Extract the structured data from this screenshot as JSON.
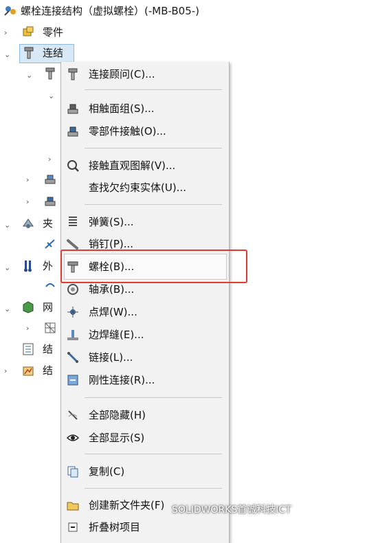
{
  "tree": {
    "title": "螺栓连接结构（虚拟螺栓）(-MB-B05-)",
    "parts_label": "零件",
    "connections_label": "连结",
    "fixtures_label": "夹",
    "external_loads_label": "外",
    "mesh_label": "网",
    "result_options_label": "结",
    "results_label": "结"
  },
  "context_menu": {
    "items": [
      {
        "label": "连接顾问(C)...",
        "icon": "connection-advisor-icon"
      },
      {
        "label": "相触面组(S)...",
        "icon": "contact-set-icon"
      },
      {
        "label": "零部件接触(O)...",
        "icon": "component-contact-icon"
      },
      {
        "label": "接触直观图解(V)...",
        "icon": "contact-visualization-icon"
      },
      {
        "label": "查找欠约束实体(U)...",
        "icon": ""
      },
      {
        "label": "弹簧(S)...",
        "icon": "spring-icon"
      },
      {
        "label": "销钉(P)...",
        "icon": "pin-icon"
      },
      {
        "label": "螺栓(B)...",
        "icon": "bolt-icon"
      },
      {
        "label": "轴承(B)...",
        "icon": "bearing-icon"
      },
      {
        "label": "点焊(W)...",
        "icon": "spot-weld-icon"
      },
      {
        "label": "边焊缝(E)...",
        "icon": "edge-weld-icon"
      },
      {
        "label": "链接(L)...",
        "icon": "link-icon"
      },
      {
        "label": "刚性连接(R)...",
        "icon": "rigid-connection-icon"
      },
      {
        "label": "全部隐藏(H)",
        "icon": "hide-all-icon"
      },
      {
        "label": "全部显示(S)",
        "icon": "show-all-icon"
      },
      {
        "label": "复制(C)",
        "icon": "copy-icon"
      },
      {
        "label": "创建新文件夹(F)",
        "icon": "folder-icon"
      },
      {
        "label": "折叠树项目",
        "icon": "collapse-icon"
      }
    ]
  },
  "watermark": "SOLIDWORKS首诚科技ICT",
  "colors": {
    "highlight_box": "#e23a2e",
    "selection": "#d7e8f7"
  }
}
